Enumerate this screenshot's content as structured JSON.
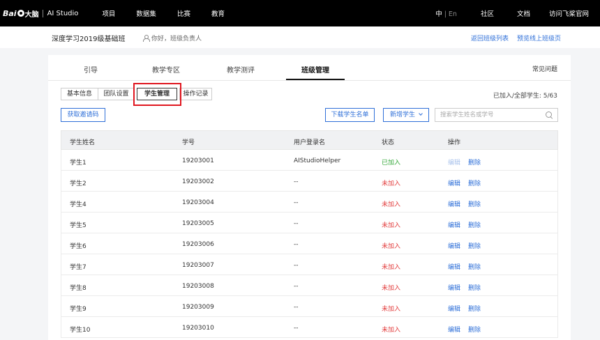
{
  "topnav": {
    "logo_bai": "Bai",
    "logo_du": "大脑",
    "logo_studio": "AI Studio",
    "items": [
      "项目",
      "数据集",
      "比赛",
      "教育"
    ],
    "lang_zh": "中",
    "lang_sep": "|",
    "lang_en": "En",
    "right_items": [
      "社区",
      "文档",
      "访问飞桨官网"
    ]
  },
  "subheader": {
    "class_title": "深度学习2019级基础班",
    "greeting": "你好，班级负责人",
    "links": [
      "返回班级列表",
      "预览线上班级页"
    ]
  },
  "tabs": {
    "items": [
      "引导",
      "教学专区",
      "教学测评",
      "班级管理"
    ],
    "active": "班级管理",
    "faq": "常见问题"
  },
  "segments": {
    "items": [
      "基本信息",
      "团队设置",
      "学生管理",
      "操作记录"
    ],
    "active": "学生管理"
  },
  "joined_count": "已加入/全部学生: 5/63",
  "toolbar": {
    "invite": "获取邀请码",
    "download": "下载学生名单",
    "add": "新增学生",
    "search_placeholder": "搜索学生姓名或学号"
  },
  "table": {
    "headers": [
      "学生姓名",
      "学号",
      "用户登录名",
      "状态",
      "操作"
    ],
    "rows": [
      {
        "name": "学生1",
        "id": "19203001",
        "login": "AIStudioHelper",
        "status": "已加入",
        "joined": true,
        "edit": "编辑",
        "delete": "删除"
      },
      {
        "name": "学生2",
        "id": "19203002",
        "login": "--",
        "status": "未加入",
        "joined": false,
        "edit": "编辑",
        "delete": "删除"
      },
      {
        "name": "学生4",
        "id": "19203004",
        "login": "--",
        "status": "未加入",
        "joined": false,
        "edit": "编辑",
        "delete": "删除"
      },
      {
        "name": "学生5",
        "id": "19203005",
        "login": "--",
        "status": "未加入",
        "joined": false,
        "edit": "编辑",
        "delete": "删除"
      },
      {
        "name": "学生6",
        "id": "19203006",
        "login": "--",
        "status": "未加入",
        "joined": false,
        "edit": "编辑",
        "delete": "删除"
      },
      {
        "name": "学生7",
        "id": "19203007",
        "login": "--",
        "status": "未加入",
        "joined": false,
        "edit": "编辑",
        "delete": "删除"
      },
      {
        "name": "学生8",
        "id": "19203008",
        "login": "--",
        "status": "未加入",
        "joined": false,
        "edit": "编辑",
        "delete": "删除"
      },
      {
        "name": "学生9",
        "id": "19203009",
        "login": "--",
        "status": "未加入",
        "joined": false,
        "edit": "编辑",
        "delete": "删除"
      },
      {
        "name": "学生10",
        "id": "19203010",
        "login": "--",
        "status": "未加入",
        "joined": false,
        "edit": "编辑",
        "delete": "删除"
      }
    ]
  },
  "colors": {
    "accent": "#2e6fd8",
    "joined": "#35a83a",
    "not_joined": "#e23c3c",
    "highlight": "#e0161f"
  }
}
